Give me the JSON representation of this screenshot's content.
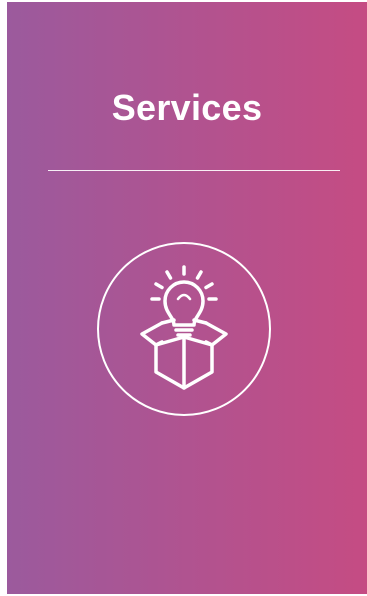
{
  "card": {
    "title": "Services",
    "icon": "lightbulb-box-icon"
  },
  "colors": {
    "gradient_start": "#9b5a9d",
    "gradient_end": "#c54c83",
    "foreground": "#ffffff"
  }
}
